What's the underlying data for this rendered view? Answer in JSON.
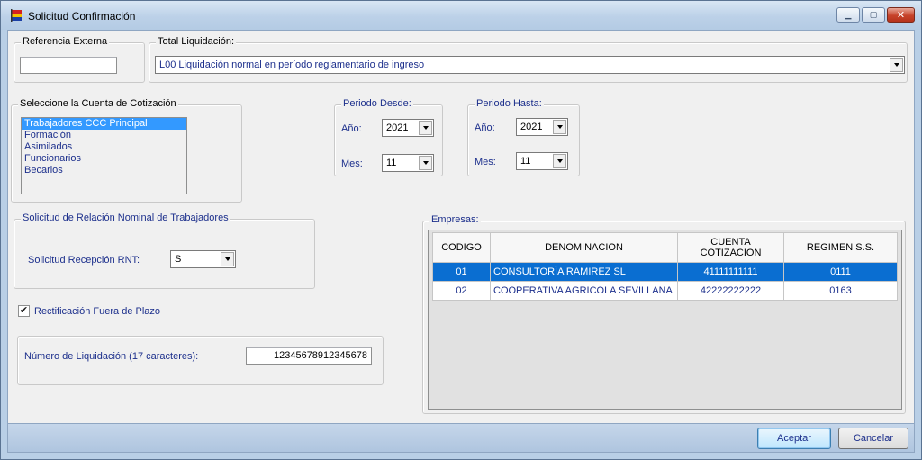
{
  "window": {
    "title": "Solicitud Confirmación"
  },
  "referencia": {
    "legend": "Referencia Externa",
    "value": ""
  },
  "total": {
    "legend": "Total Liquidación:",
    "value": "L00 Liquidación normal en período reglamentario de ingreso"
  },
  "cuenta": {
    "legend": "Seleccione la Cuenta de Cotización",
    "items": [
      "Trabajadores CCC Principal",
      "Formación",
      "Asimilados",
      "Funcionarios",
      "Becarios"
    ],
    "selected_index": 0
  },
  "desde": {
    "legend": "Periodo Desde:",
    "anio_label": "Año:",
    "anio": "2021",
    "mes_label": "Mes:",
    "mes": "11"
  },
  "hasta": {
    "legend": "Periodo Hasta:",
    "anio_label": "Año:",
    "anio": "2021",
    "mes_label": "Mes:",
    "mes": "11"
  },
  "rnt": {
    "legend": "Solicitud de Relación Nominal de Trabajadores",
    "label": "Solicitud Recepción RNT:",
    "value": "S"
  },
  "rectificacion": {
    "label": "Rectificación Fuera de Plazo",
    "checked": true,
    "check_glyph": "✔"
  },
  "liquidacion": {
    "label": "Número de Liquidación (17 caracteres):",
    "value": "12345678912345678"
  },
  "empresas": {
    "legend": "Empresas:",
    "columns": [
      "CODIGO",
      "DENOMINACION",
      "CUENTA\nCOTIZACION",
      "REGIMEN S.S."
    ],
    "rows": [
      {
        "codigo": "01",
        "denominacion": "CONSULTORÍA RAMIREZ SL",
        "cuenta": "41111111111",
        "regimen": "0111"
      },
      {
        "codigo": "02",
        "denominacion": "COOPERATIVA AGRICOLA SEVILLANA",
        "cuenta": "42222222222",
        "regimen": "0163"
      }
    ],
    "selected_index": 0
  },
  "buttons": {
    "aceptar": "Aceptar",
    "cancelar": "Cancelar"
  },
  "colors": {
    "accent": "#3399ff",
    "label_blue": "#1c2f8c",
    "selection": "#0a6ed1"
  }
}
